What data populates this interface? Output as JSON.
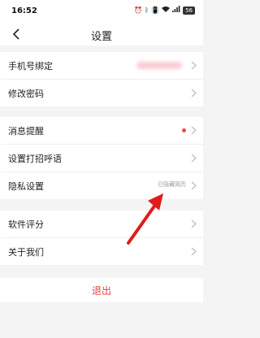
{
  "status_bar": {
    "time": "16:52",
    "battery": "56"
  },
  "nav": {
    "title": "设置"
  },
  "groups": [
    {
      "items": [
        {
          "id": "phone-binding",
          "label": "手机号绑定",
          "value": ""
        },
        {
          "id": "change-password",
          "label": "修改密码",
          "value": ""
        }
      ]
    },
    {
      "items": [
        {
          "id": "message-reminder",
          "label": "消息提醒",
          "value": "",
          "badge": "red-dot"
        },
        {
          "id": "greeting",
          "label": "设置打招呼语",
          "value": ""
        },
        {
          "id": "privacy",
          "label": "隐私设置",
          "value": "已隐藏简历"
        }
      ]
    },
    {
      "items": [
        {
          "id": "rate-app",
          "label": "软件评分",
          "value": ""
        },
        {
          "id": "about-us",
          "label": "关于我们",
          "value": ""
        }
      ]
    }
  ],
  "logout": {
    "label": "退出"
  },
  "colors": {
    "accent_red": "#e4453f",
    "badge_red": "#e84a4a",
    "annotation_arrow": "#e11b1b",
    "background": "#f4f4f4"
  }
}
